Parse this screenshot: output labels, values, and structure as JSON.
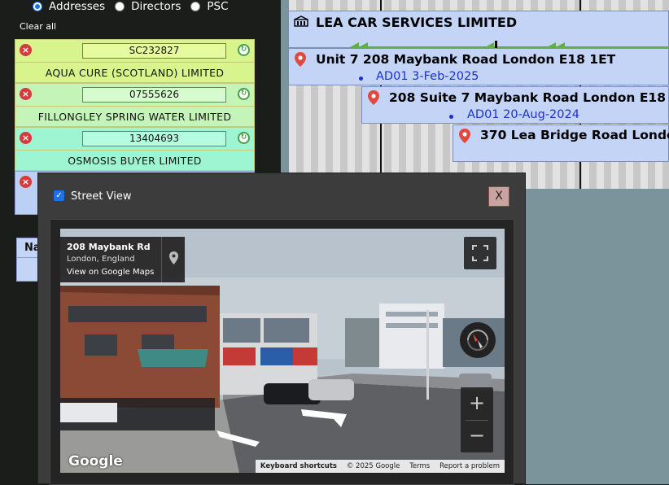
{
  "search_mode": {
    "options": [
      {
        "label": "Addresses",
        "selected": true
      },
      {
        "label": "Directors",
        "selected": false
      },
      {
        "label": "PSC",
        "selected": false
      }
    ]
  },
  "clear_all_label": "Clear all",
  "companies_list": [
    {
      "number": "SC232827",
      "name": "AQUA CURE (SCOTLAND) LIMITED"
    },
    {
      "number": "07555626",
      "name": "FILLONGLEY SPRING WATER LIMITED"
    },
    {
      "number": "13404693",
      "name": "OSMOSIS BUYER LIMITED"
    }
  ],
  "table_header_partial": "Na",
  "timeline": {
    "company": "LEA CAR SERVICES LIMITED",
    "addresses": [
      {
        "text": "Unit 7 208 Maybank Road London E18 1ET",
        "tag": "AD01 3-Feb-2025"
      },
      {
        "text": "208 Suite 7 Maybank Road London E18",
        "tag": "AD01 20-Aug-2024"
      },
      {
        "text": "370 Lea Bridge Road Londo",
        "tag": ""
      }
    ]
  },
  "street_view": {
    "label": "Street View",
    "checked": true,
    "close_label": "X",
    "place_title": "208 Maybank Rd",
    "place_subtitle": "London, England",
    "maps_link": "View on Google Maps",
    "logo": "Google",
    "footer": {
      "shortcuts": "Keyboard shortcuts",
      "copyright": "© 2025 Google",
      "terms": "Terms",
      "report": "Report a problem"
    },
    "zoom_in": "+",
    "zoom_out": "−"
  },
  "colors": {
    "accent_blue": "#1a73e8",
    "timeline_green": "#5cb045",
    "tag_blue": "#1e2fcf",
    "delete_red": "#d63a3a"
  }
}
